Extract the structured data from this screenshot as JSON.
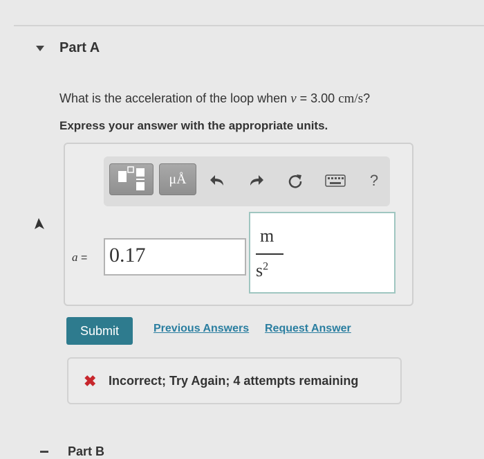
{
  "part": {
    "title": "Part A"
  },
  "question": {
    "prefix": "What is the acceleration of the loop when ",
    "variable": "v",
    "equals": " = 3.00 ",
    "unit": "cm/s",
    "suffix": "?"
  },
  "instruction": "Express your answer with the appropriate units.",
  "toolbar": {
    "units_label": "μÅ",
    "help_label": "?",
    "icons": [
      "templates-icon",
      "units-icon",
      "undo-icon",
      "redo-icon",
      "reset-icon",
      "keyboard-icon",
      "help-icon"
    ]
  },
  "answer": {
    "variable": "a",
    "equals": "=",
    "value": "0.17",
    "unit_numerator": "m",
    "unit_denominator": "s",
    "unit_exponent": "2"
  },
  "actions": {
    "submit_label": "Submit",
    "previous_answers_label": "Previous Answers",
    "request_answer_label": "Request Answer"
  },
  "feedback": {
    "icon": "x-icon",
    "text": "Incorrect; Try Again; 4 attempts remaining",
    "color": "#c7262c"
  },
  "next_part": {
    "title": "Part B"
  },
  "colors": {
    "accent": "#2e7b8e",
    "link": "#2a7ea0",
    "error": "#c7262c"
  }
}
